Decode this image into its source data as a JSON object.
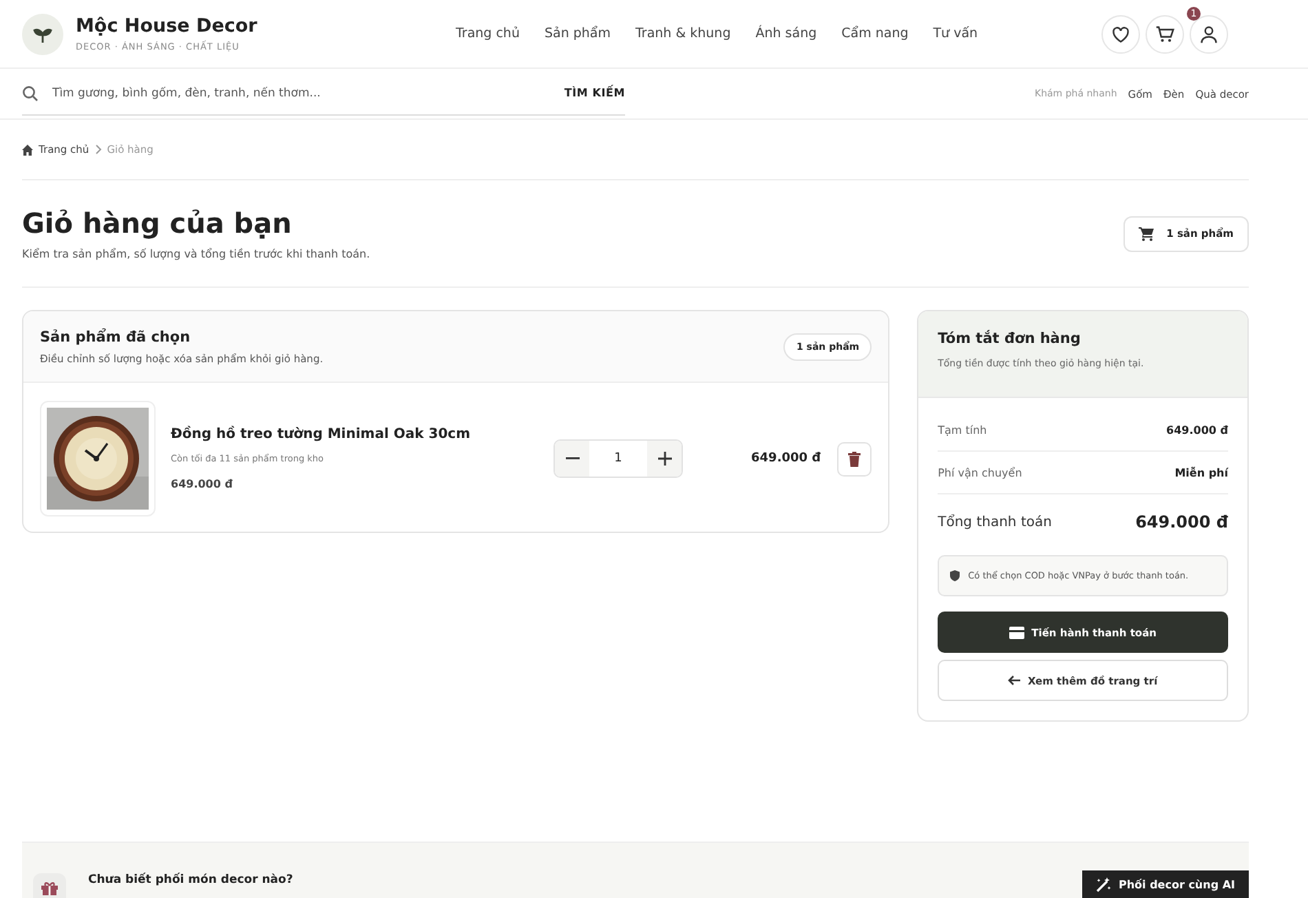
{
  "brand": {
    "name": "Mộc House Decor",
    "tagline": "DECOR · ÁNH SÁNG · CHẤT LIỆU"
  },
  "nav": [
    {
      "label": "Trang chủ",
      "selected": false
    },
    {
      "label": "Sản phẩm",
      "selected": false
    },
    {
      "label": "Tranh & khung",
      "selected": false
    },
    {
      "label": "Ánh sáng",
      "selected": false
    },
    {
      "label": "Cẩm nang",
      "selected": false
    },
    {
      "label": "Tư vấn",
      "selected": false
    }
  ],
  "cart_badge": "1",
  "search": {
    "placeholder": "Tìm gương, bình gốm, đèn, tranh, nến thơm...",
    "button": "TÌM KIẾM"
  },
  "quick_links": {
    "label": "Khám phá nhanh",
    "items": [
      "Gốm",
      "Đèn",
      "Quà decor"
    ]
  },
  "breadcrumb": [
    "Trang chủ",
    "Giỏ hàng"
  ],
  "page": {
    "title": "Giỏ hàng của bạn",
    "subtitle": "Kiểm tra sản phẩm, số lượng và tổng tiền trước khi thanh toán.",
    "count": "1 sản phẩm"
  },
  "cart": {
    "title": "Sản phẩm đã chọn",
    "subtitle": "Điều chỉnh số lượng hoặc xóa sản phẩm khỏi giỏ hàng.",
    "count": "1 sản phẩm",
    "items": [
      {
        "name": "Đồng hồ treo tường Minimal Oak 30cm",
        "stock": "Còn tối đa 11 sản phẩm trong kho",
        "price": "649.000 đ",
        "quantity": "1",
        "total": "649.000 đ"
      }
    ]
  },
  "summary": {
    "title": "Tóm tắt đơn hàng",
    "subtitle": "Tổng tiền được tính theo giỏ hàng hiện tại.",
    "rows": [
      {
        "label": "Tạm tính",
        "value": "649.000 đ"
      },
      {
        "label": "Phí vận chuyển",
        "value": "Miễn phí"
      }
    ],
    "total_label": "Tổng thanh toán",
    "total_value": "649.000 đ",
    "note": "Có thể chọn COD hoặc VNPay ở bước thanh toán.",
    "checkout": "Tiến hành thanh toán",
    "continue": "Xem thêm đồ trang trí"
  },
  "banner": {
    "text": "Chưa biết phối món decor nào?",
    "button": "Phối decor cùng AI"
  }
}
